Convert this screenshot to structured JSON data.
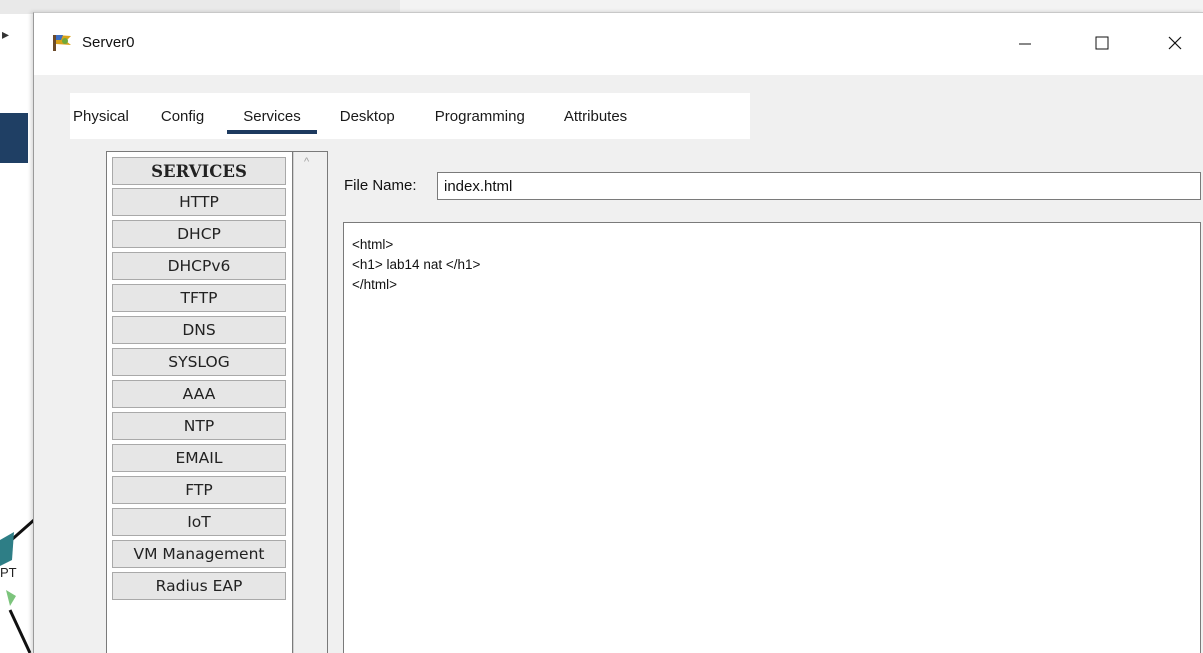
{
  "window": {
    "title": "Server0"
  },
  "background": {
    "label_fragment": "PT"
  },
  "tabs": [
    {
      "label": "Physical",
      "active": false
    },
    {
      "label": "Config",
      "active": false
    },
    {
      "label": "Services",
      "active": true
    },
    {
      "label": "Desktop",
      "active": false
    },
    {
      "label": "Programming",
      "active": false
    },
    {
      "label": "Attributes",
      "active": false
    }
  ],
  "services": {
    "header": "SERVICES",
    "items": [
      "HTTP",
      "DHCP",
      "DHCPv6",
      "TFTP",
      "DNS",
      "SYSLOG",
      "AAA",
      "NTP",
      "EMAIL",
      "FTP",
      "IoT",
      "VM Management",
      "Radius EAP"
    ]
  },
  "http": {
    "file_name_label": "File Name:",
    "file_name_value": "index.html",
    "content_lines": [
      "<html>",
      "<h1> lab14 nat </h1>",
      "</html>"
    ]
  },
  "colors": {
    "tab_underline": "#1d3a5f",
    "window_bg": "#f0f0f0"
  }
}
